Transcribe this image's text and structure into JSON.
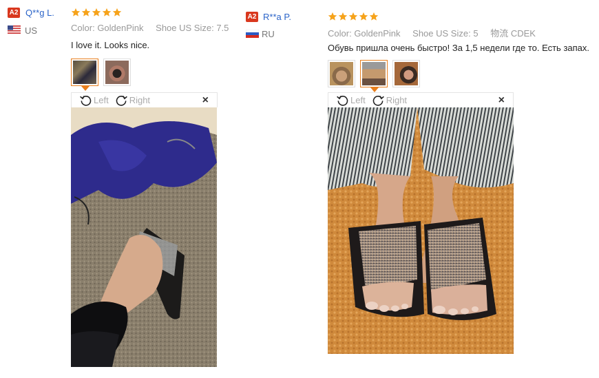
{
  "reviews": [
    {
      "badge": "A2",
      "name": "Q**g L.",
      "country": "US",
      "stars": 5,
      "color_label": "Color:",
      "color_value": "GoldenPink",
      "size_label": "Shoe US Size:",
      "size_value": "7.5",
      "text": "I love it. Looks nice.",
      "viewer": {
        "left": "Left",
        "right": "Right",
        "close": "×"
      }
    },
    {
      "badge": "A2",
      "name": "R**a P.",
      "country": "RU",
      "stars": 5,
      "color_label": "Color:",
      "color_value": "GoldenPink",
      "size_label": "Shoe US Size:",
      "size_value": "5",
      "ship_label": "物流",
      "ship_value": "CDEK",
      "text": "Обувь пришла очень быстро! За 1,5 недели где то. Есть запах.",
      "viewer": {
        "left": "Left",
        "right": "Right",
        "close": "×"
      }
    }
  ],
  "colors": {
    "star": "#f6a31b",
    "badge": "#d9381e",
    "name": "#2a63c8",
    "active_thumb": "#e87e1d"
  }
}
